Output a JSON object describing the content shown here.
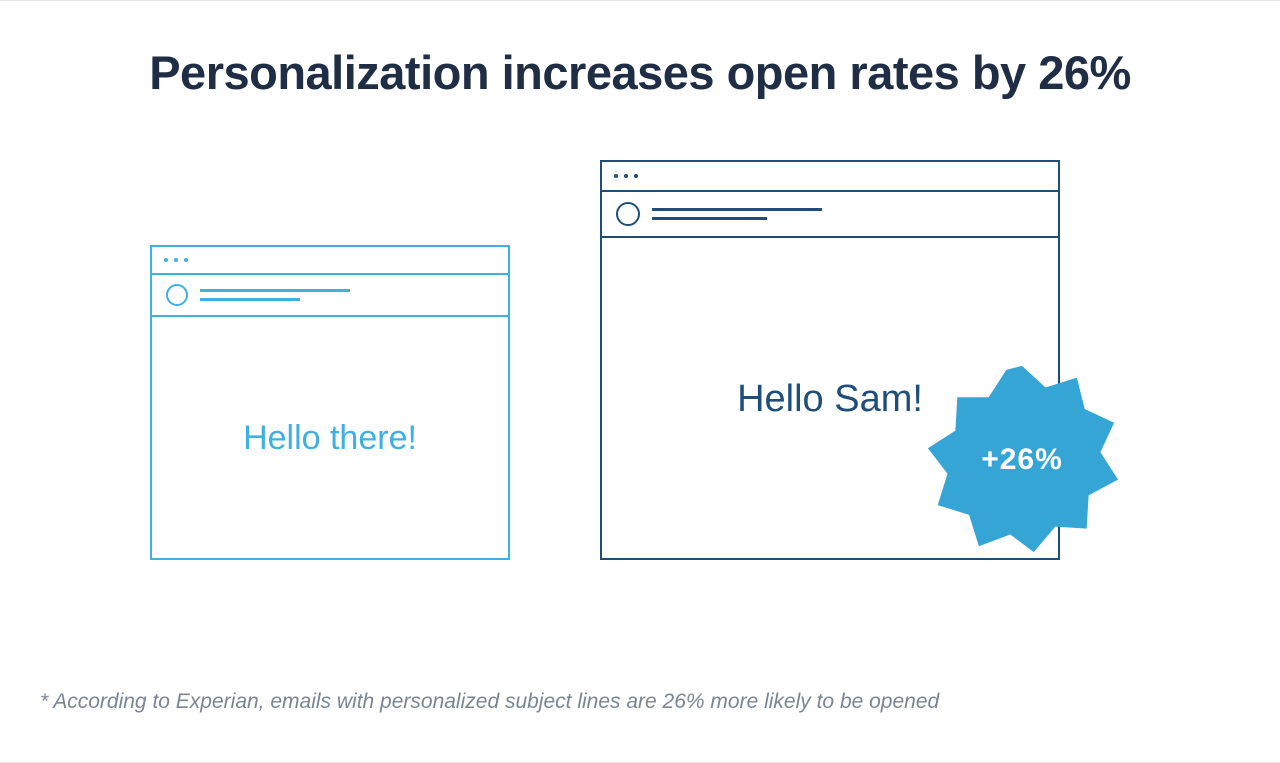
{
  "headline": "Personalization increases open rates by 26%",
  "windows": {
    "generic": {
      "greeting": "Hello there!"
    },
    "personalized": {
      "greeting": "Hello Sam!"
    }
  },
  "badge": {
    "label": "+26%"
  },
  "footnote": "* According to Experian, emails with personalized subject lines are 26% more likely to be opened",
  "colors": {
    "light_blue": "#3fb0e3",
    "dark_blue": "#1f4e79",
    "badge_fill": "#35a5d6",
    "text_dark": "#1f2e45",
    "text_muted": "#7a8694"
  }
}
